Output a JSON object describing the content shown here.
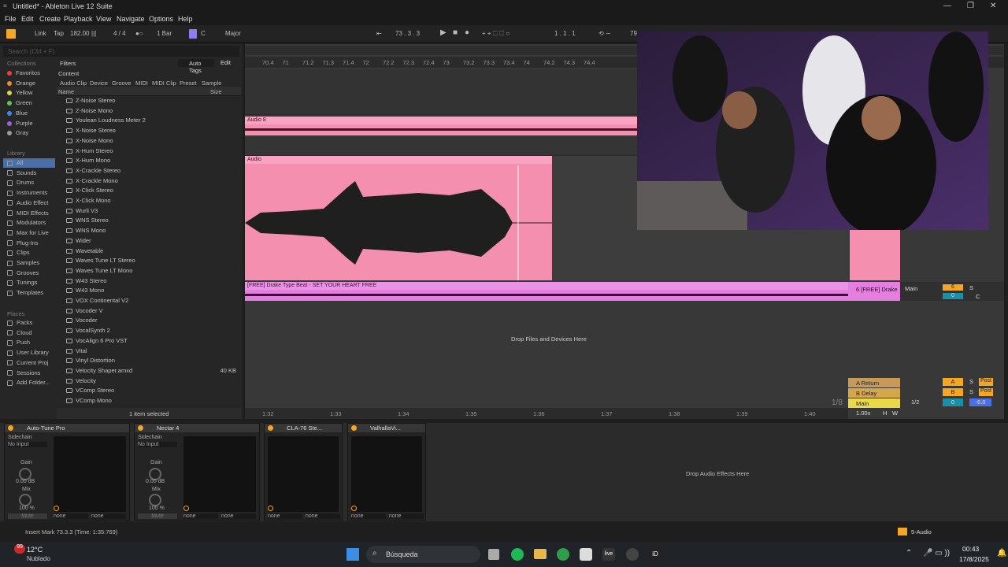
{
  "window": {
    "title": "Untitled* - Ableton Live 12 Suite"
  },
  "menu": [
    "File",
    "Edit",
    "Create",
    "Playback",
    "View",
    "Navigate",
    "Options",
    "Help"
  ],
  "control_bar": {
    "link": "Link",
    "tap": "Tap",
    "tempo": "182.00",
    "time_sig": "4 / 4",
    "quantize": "1 Bar",
    "key": "C",
    "scale": "Major",
    "position": "73 .  3 .  3",
    "loop_start": "1 .  1 .  1",
    "loop_len": "79"
  },
  "browser": {
    "search_placeholder": "Search (Ctrl + F)",
    "filters": "Filters",
    "auto_tags": "Auto Tags",
    "edit": "Edit",
    "content": "Content",
    "tabs": [
      "Audio Clip",
      "Device",
      "Groove",
      "MIDI",
      "MIDI Clip",
      "Preset",
      "Sample"
    ],
    "col_name": "Name",
    "col_size": "Size",
    "collections_title": "Collections",
    "collections": [
      {
        "label": "Favoritos",
        "color": "#e8413c"
      },
      {
        "label": "Orange",
        "color": "#f08a24"
      },
      {
        "label": "Yellow",
        "color": "#e8d23c"
      },
      {
        "label": "Green",
        "color": "#5cc65a"
      },
      {
        "label": "Blue",
        "color": "#3c8ae8"
      },
      {
        "label": "Purple",
        "color": "#a35ce8"
      },
      {
        "label": "Gray",
        "color": "#9a9a9a"
      }
    ],
    "library_title": "Library",
    "library": [
      "All",
      "Sounds",
      "Drums",
      "Instruments",
      "Audio Effect",
      "MIDI Effects",
      "Modulators",
      "Max for Live",
      "Plug-Ins",
      "Clips",
      "Samples",
      "Grooves",
      "Tunings",
      "Templates"
    ],
    "places_title": "Places",
    "places": [
      "Packs",
      "Cloud",
      "Push",
      "User Library",
      "Current Proj",
      "Sessions",
      "Add Folder..."
    ],
    "files": [
      {
        "name": "Z-Noise Stereo",
        "size": ""
      },
      {
        "name": "Z-Noise Mono",
        "size": ""
      },
      {
        "name": "Youlean Loudness Meter 2",
        "size": ""
      },
      {
        "name": "X-Noise Stereo",
        "size": ""
      },
      {
        "name": "X-Noise Mono",
        "size": ""
      },
      {
        "name": "X-Hum Stereo",
        "size": ""
      },
      {
        "name": "X-Hum Mono",
        "size": ""
      },
      {
        "name": "X-Crackle Stereo",
        "size": ""
      },
      {
        "name": "X-Crackle Mono",
        "size": ""
      },
      {
        "name": "X-Click Stereo",
        "size": ""
      },
      {
        "name": "X-Click Mono",
        "size": ""
      },
      {
        "name": "Wurli V3",
        "size": ""
      },
      {
        "name": "WNS Stereo",
        "size": ""
      },
      {
        "name": "WNS Mono",
        "size": ""
      },
      {
        "name": "Wider",
        "size": ""
      },
      {
        "name": "Wavetable",
        "size": ""
      },
      {
        "name": "Waves Tune LT Stereo",
        "size": ""
      },
      {
        "name": "Waves Tune LT Mono",
        "size": ""
      },
      {
        "name": "W43 Stereo",
        "size": ""
      },
      {
        "name": "W43 Mono",
        "size": ""
      },
      {
        "name": "VOX Continental V2",
        "size": ""
      },
      {
        "name": "Vocoder V",
        "size": ""
      },
      {
        "name": "Vocoder",
        "size": ""
      },
      {
        "name": "VocalSynth 2",
        "size": ""
      },
      {
        "name": "VocAlign 6 Pro VST",
        "size": ""
      },
      {
        "name": "Vital",
        "size": ""
      },
      {
        "name": "Vinyl Distortion",
        "size": ""
      },
      {
        "name": "Velocity Shaper.amxd",
        "size": "40 KB"
      },
      {
        "name": "Velocity",
        "size": ""
      },
      {
        "name": "VComp Stereo",
        "size": ""
      },
      {
        "name": "VComp Mono",
        "size": ""
      }
    ],
    "selection": "1 item selected"
  },
  "arrangement": {
    "top_ruler": [
      "70.4",
      "71",
      "71.2",
      "71.3",
      "71.4",
      "72",
      "72.2",
      "72.3",
      "72.4",
      "73",
      "73.2",
      "73.3",
      "73.4",
      "74",
      "74.2",
      "74.3",
      "74.4"
    ],
    "bottom_ruler": [
      "1:32",
      "1:33",
      "1:34",
      "1:35",
      "1:36",
      "1:37",
      "1:38",
      "1:39",
      "1:40"
    ],
    "clip_audio8": "Audio 8",
    "clip_audio": "Audio",
    "clip_beat": "[FREE] Drake Type Beat - SET YOUR HEART FREE",
    "drop_text": "Drop Files and Devices Here",
    "track_name": "6 [FREE] Drake",
    "track_out": "Main",
    "track_num": "6",
    "track_vol": "0",
    "solo": "S",
    "cue": "C",
    "returns": [
      {
        "name": "A Return",
        "letter": "A",
        "post": "Post"
      },
      {
        "name": "B Delay",
        "letter": "B",
        "post": "Post"
      }
    ],
    "main": {
      "name": "Main",
      "out": "1/2",
      "vol": "0",
      "pan": "-6.0"
    },
    "zoom": "1/8",
    "tempo_small": "1.00x",
    "h": "H",
    "w": "W"
  },
  "devices": [
    {
      "name": "Auto-Tune Pro",
      "sidechain": "Sidechain",
      "input": "No Input",
      "gain_label": "Gain",
      "gain": "0.00 dB",
      "mix_label": "Mix",
      "mix": "100 %",
      "mute": "Mute",
      "a": "none",
      "b": "none"
    },
    {
      "name": "Nectar 4",
      "sidechain": "Sidechain",
      "input": "No Input",
      "gain_label": "Gain",
      "gain": "0.00 dB",
      "mix_label": "Mix",
      "mix": "100 %",
      "mute": "Mute",
      "a": "none",
      "b": "none"
    },
    {
      "name": "CLA-76 Ste...",
      "a": "none",
      "b": "none"
    },
    {
      "name": "ValhallaVi...",
      "a": "none",
      "b": "none"
    }
  ],
  "drop_effects": "Drop Audio Effects Here",
  "status": {
    "text": "Insert Mark 73.3.3 (Time: 1:35:769)",
    "track": "5-Audio"
  },
  "taskbar": {
    "temp": "12°C",
    "weather": "Nublado",
    "search": "Búsqueda",
    "time": "00:43",
    "date": "17/8/2025",
    "badge": "99"
  }
}
